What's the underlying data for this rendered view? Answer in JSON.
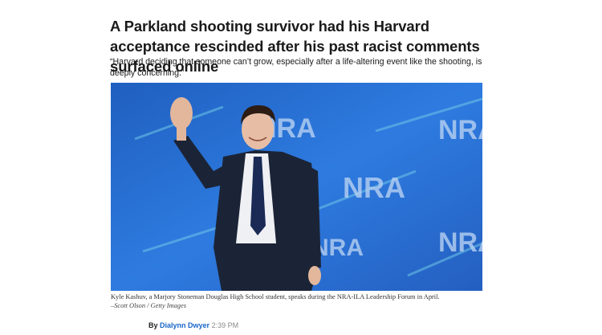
{
  "article": {
    "headline": "A Parkland shooting survivor had his Harvard acceptance rescinded after his past racist comments surfaced online",
    "dek": "“Harvard deciding that someone can’t grow, especially after a life-altering event like the shooting, is deeply concerning.”",
    "photo": {
      "background_text": "NRA",
      "caption": "Kyle Kashuv, a Marjory Stoneman Douglas High School student, speaks during the NRA-ILA Leadership Forum in April.",
      "credit": "–Scott Olson / Getty Images"
    },
    "byline": {
      "prefix": "By",
      "author": "Dialynn Dwyer",
      "time": "2:39 PM"
    }
  },
  "colors": {
    "photo_bg": "#2a6fcf",
    "link": "#1866c9",
    "suit": "#1b2436",
    "tie": "#1a2a55"
  }
}
